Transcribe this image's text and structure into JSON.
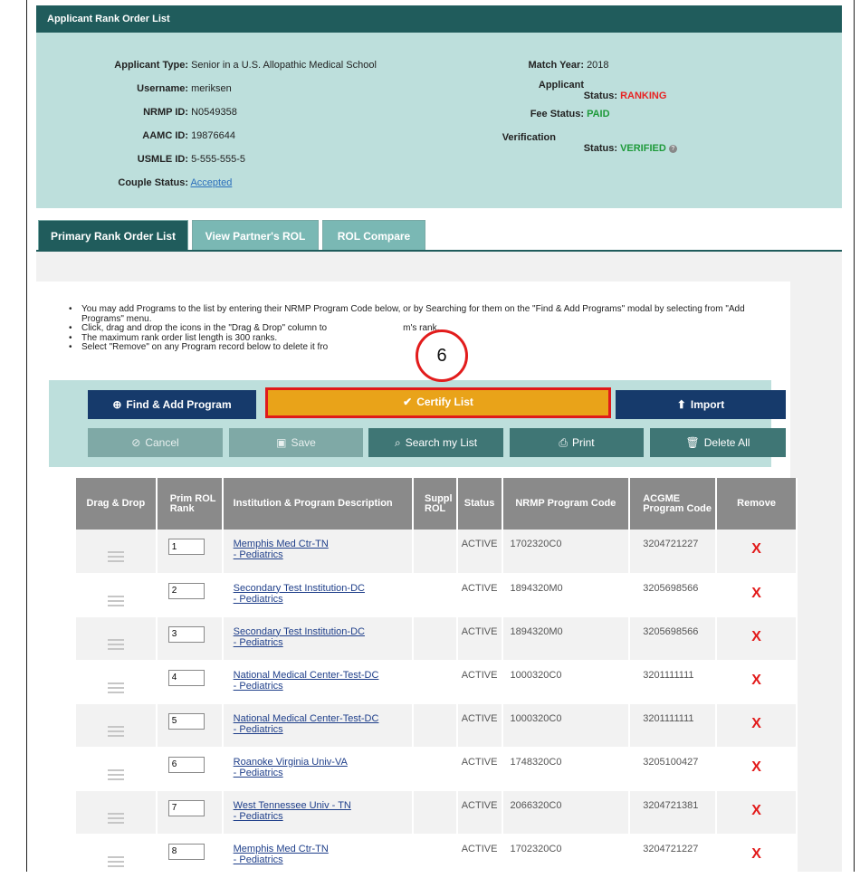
{
  "header": {
    "title": "Applicant Rank Order List"
  },
  "applicant": {
    "left": [
      {
        "label": "Applicant Type:",
        "value": "Senior in a U.S. Allopathic Medical School"
      },
      {
        "label": "Username:",
        "value": "meriksen"
      },
      {
        "label": "NRMP ID:",
        "value": "N0549358"
      },
      {
        "label": "AAMC ID:",
        "value": "19876644"
      },
      {
        "label": "USMLE ID:",
        "value": "5-555-555-5"
      },
      {
        "label": "Couple Status:",
        "value": "Accepted"
      }
    ],
    "match_year_label": "Match Year:",
    "match_year": "2018",
    "applicant_status_label_1": "Applicant",
    "applicant_status_label_2": "Status:",
    "applicant_status": "RANKING",
    "fee_status_label": "Fee Status:",
    "fee_status": "PAID",
    "verification_label_1": "Verification",
    "verification_label_2": "Status:",
    "verification_status": "VERIFIED",
    "colors": {
      "ranking": "#e82323",
      "paid": "#1e9a3a",
      "verified": "#1e9a3a"
    }
  },
  "tabs": [
    {
      "label": "Primary Rank Order List",
      "active": true
    },
    {
      "label": "View Partner's ROL",
      "active": false
    },
    {
      "label": "ROL Compare",
      "active": false
    }
  ],
  "instructions": [
    "You may add Programs to the list by entering their NRMP Program Code below, or by Searching for them on the \"Find & Add Programs\" modal by selecting from \"Add Programs\" menu.",
    "Click, drag and drop the icons in the \"Drag & Drop\" column to",
    "The maximum rank order list length is 300 ranks.",
    "Select \"Remove\" on any Program record below to delete it fro"
  ],
  "instruction_tail": "m's rank.",
  "callout_number": "6",
  "toolbar": {
    "find_add": "Find & Add Program",
    "certify": "Certify List",
    "import": "Import",
    "cancel": "Cancel",
    "save": "Save",
    "search": "Search my List",
    "print": "Print",
    "delete_all": "Delete All"
  },
  "table": {
    "headers": {
      "drag": "Drag & Drop",
      "rank": "Prim ROL Rank",
      "institution": "Institution & Program Description",
      "suppl": "Suppl ROL",
      "status": "Status",
      "nrmp": "NRMP Program Code",
      "acgme": "ACGME Program Code",
      "remove": "Remove"
    },
    "rows": [
      {
        "rank": "1",
        "institution": "Memphis Med Ctr-TN",
        "program": "- Pediatrics",
        "status": "ACTIVE",
        "nrmp": "1702320C0",
        "acgme": "3204721227",
        "remove": "X"
      },
      {
        "rank": "2",
        "institution": "Secondary Test Institution-DC",
        "program": "- Pediatrics",
        "status": "ACTIVE",
        "nrmp": "1894320M0",
        "acgme": "3205698566",
        "remove": "X"
      },
      {
        "rank": "3",
        "institution": "Secondary Test Institution-DC",
        "program": "- Pediatrics",
        "status": "ACTIVE",
        "nrmp": "1894320M0",
        "acgme": "3205698566",
        "remove": "X"
      },
      {
        "rank": "4",
        "institution": "National Medical Center-Test-DC",
        "program": "- Pediatrics",
        "status": "ACTIVE",
        "nrmp": "1000320C0",
        "acgme": "3201111111",
        "remove": "X"
      },
      {
        "rank": "5",
        "institution": "National Medical Center-Test-DC",
        "program": "- Pediatrics",
        "status": "ACTIVE",
        "nrmp": "1000320C0",
        "acgme": "3201111111",
        "remove": "X"
      },
      {
        "rank": "6",
        "institution": "Roanoke Virginia Univ-VA",
        "program": "- Pediatrics",
        "status": "ACTIVE",
        "nrmp": "1748320C0",
        "acgme": "3205100427",
        "remove": "X"
      },
      {
        "rank": "7",
        "institution": "West Tennessee Univ - TN",
        "program": "- Pediatrics",
        "status": "ACTIVE",
        "nrmp": "2066320C0",
        "acgme": "3204721381",
        "remove": "X"
      },
      {
        "rank": "8",
        "institution": "Memphis Med Ctr-TN",
        "program": "- Pediatrics",
        "status": "ACTIVE",
        "nrmp": "1702320C0",
        "acgme": "3204721227",
        "remove": "X"
      }
    ]
  }
}
